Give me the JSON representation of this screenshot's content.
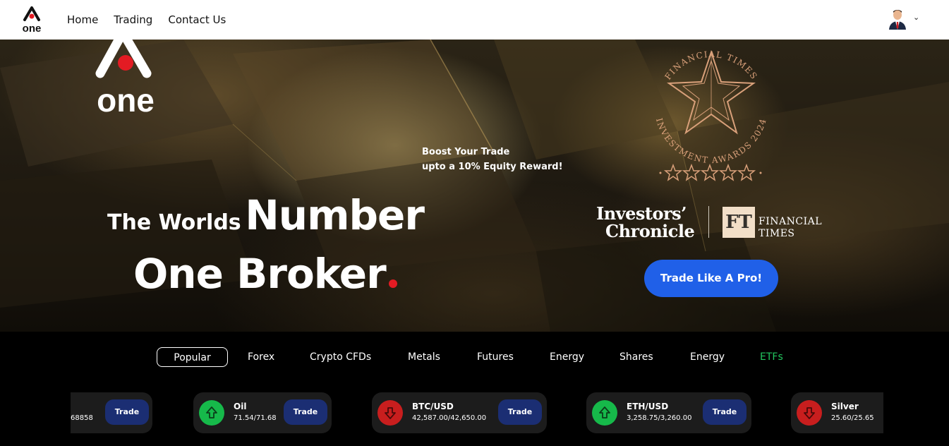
{
  "nav": {
    "logo_text": "one",
    "links": [
      "Home",
      "Trading",
      "Contact Us"
    ]
  },
  "hero": {
    "logo_text": "one",
    "boost_line1": "Boost Your Trade",
    "boost_line2": "upto a 10% Equity Reward!",
    "headline_small": "The Worlds",
    "headline_big": "Number",
    "headline_line2": "One Broker",
    "award": {
      "top_text": "FINANCIAL TIMES",
      "bottom_text": "INVESTMENT AWARDS 2024"
    },
    "investors_chronicle_l1": "Investors’",
    "investors_chronicle_l2": "Chronicle",
    "ft_mark": "FT",
    "ft_text_l1": "FINANCIAL",
    "ft_text_l2": "TIMES",
    "cta_label": "Trade Like A Pro!"
  },
  "tabs": [
    "Popular",
    "Forex",
    "Crypto CFDs",
    "Metals",
    "Futures",
    "Energy",
    "Shares",
    "Energy",
    "ETFs"
  ],
  "ticker": [
    {
      "symbol": "",
      "price": "68858",
      "direction": "",
      "trade_label": "Trade"
    },
    {
      "symbol": "Oil",
      "price": "71.54/71.68",
      "direction": "up",
      "trade_label": "Trade"
    },
    {
      "symbol": "BTC/USD",
      "price": "42,587.00/42,650.00",
      "direction": "down",
      "trade_label": "Trade"
    },
    {
      "symbol": "ETH/USD",
      "price": "3,258.75/3,260.00",
      "direction": "up",
      "trade_label": "Trade"
    },
    {
      "symbol": "Silver",
      "price": "25.60/25.65",
      "direction": "down",
      "trade_label": "Trade"
    }
  ],
  "colors": {
    "accent_blue": "#2060e8",
    "brand_red": "#e31b23",
    "up_green": "#16b94a",
    "down_red": "#c81e1e",
    "trade_button": "#1b2e73",
    "etf_green": "#22c55e",
    "award_copper": "#d9a07a"
  }
}
